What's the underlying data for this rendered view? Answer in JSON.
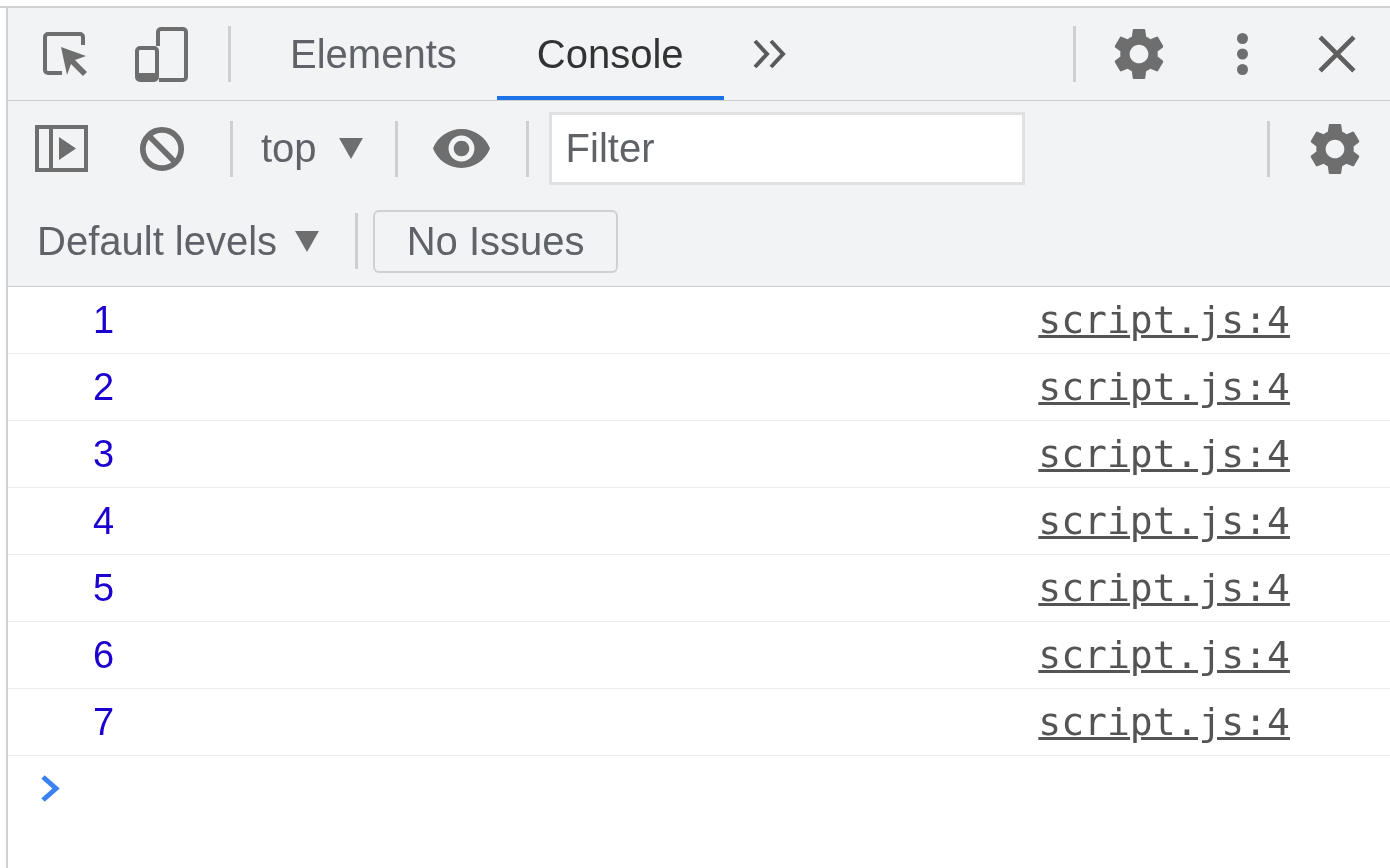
{
  "toolbar": {
    "tabs": [
      {
        "label": "Elements",
        "selected": false
      },
      {
        "label": "Console",
        "selected": true
      }
    ]
  },
  "console_toolbar": {
    "context": "top",
    "filter": {
      "placeholder": "Filter"
    },
    "log_levels": "Default levels",
    "issues": "No Issues"
  },
  "messages": [
    {
      "value": "1",
      "source": "script.js:4"
    },
    {
      "value": "2",
      "source": "script.js:4"
    },
    {
      "value": "3",
      "source": "script.js:4"
    },
    {
      "value": "4",
      "source": "script.js:4"
    },
    {
      "value": "5",
      "source": "script.js:4"
    },
    {
      "value": "6",
      "source": "script.js:4"
    },
    {
      "value": "7",
      "source": "script.js:4"
    }
  ]
}
